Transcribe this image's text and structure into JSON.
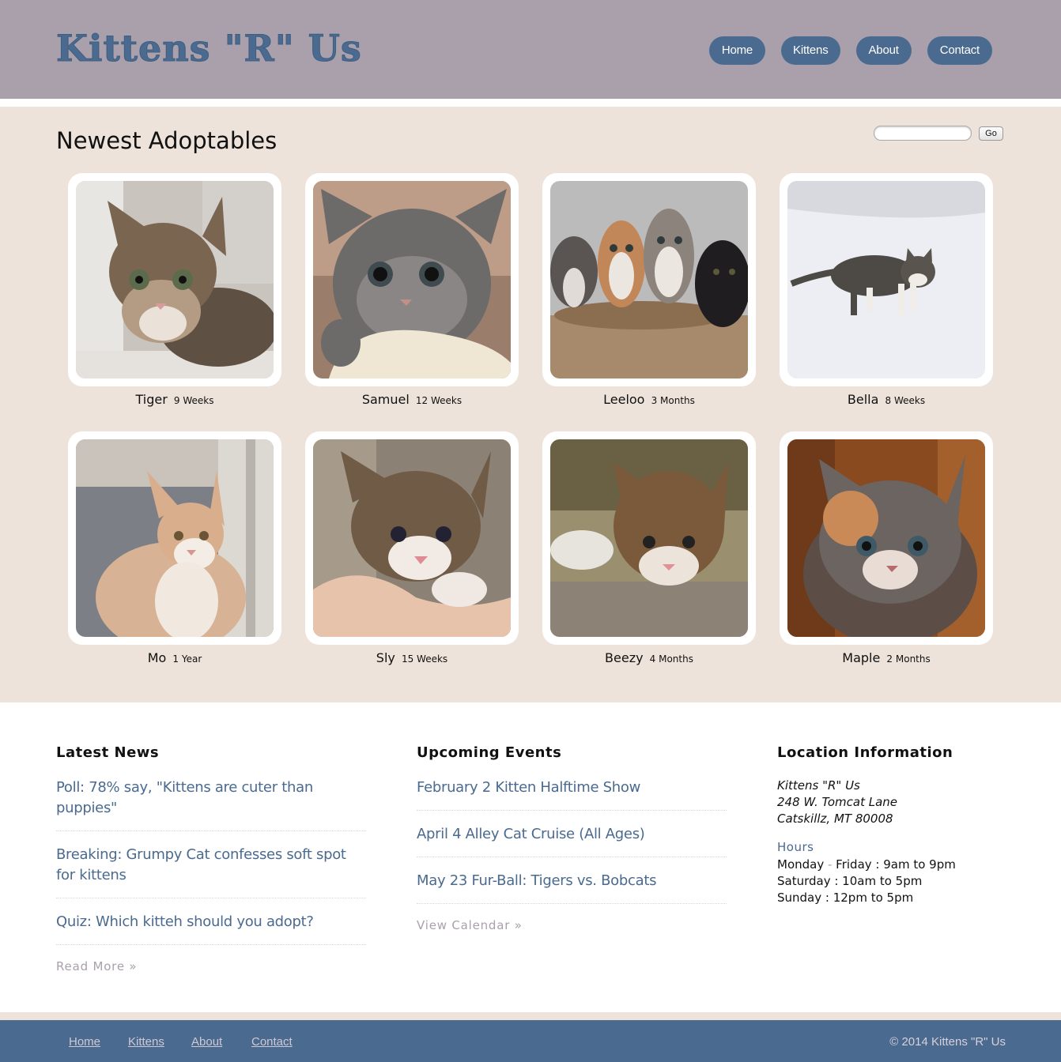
{
  "header": {
    "logo": "Kittens \"R\" Us",
    "nav": [
      "Home",
      "Kittens",
      "About",
      "Contact"
    ]
  },
  "adoptables": {
    "title": "Newest Adoptables",
    "search_placeholder": "",
    "go_label": "Go",
    "kittens": [
      {
        "name": "Tiger",
        "age": "9 Weeks"
      },
      {
        "name": "Samuel",
        "age": "12 Weeks"
      },
      {
        "name": "Leeloo",
        "age": "3 Months"
      },
      {
        "name": "Bella",
        "age": "8 Weeks"
      },
      {
        "name": "Mo",
        "age": "1 Year"
      },
      {
        "name": "Sly",
        "age": "15 Weeks"
      },
      {
        "name": "Beezy",
        "age": "4 Months"
      },
      {
        "name": "Maple",
        "age": "2 Months"
      }
    ]
  },
  "news": {
    "title": "Latest News",
    "items": [
      {
        "line1": "Poll: 78% say, \"Kittens are cuter than",
        "line2": "puppies\""
      },
      {
        "line1": "Breaking: Grumpy Cat confesses soft spot",
        "line2": "for kittens"
      },
      {
        "line1": "Quiz: Which kitteh should you adopt?",
        "line2": ""
      }
    ],
    "more": "Read More »"
  },
  "events": {
    "title": "Upcoming Events",
    "items": [
      "February 2 Kitten Halftime Show",
      "April 4 Alley Cat Cruise (All Ages)",
      "May 23 Fur-Ball: Tigers vs. Bobcats"
    ],
    "more": "View Calendar »"
  },
  "location": {
    "title": "Location Information",
    "address": [
      "Kittens \"R\" Us",
      "248 W. Tomcat Lane",
      "Catskillz, MT 80008"
    ],
    "hours_title": "Hours",
    "hours": [
      {
        "a": "Monday",
        "dash": " - ",
        "b": "Friday : 9am to 9pm"
      },
      {
        "a": "Saturday : 10am to 5pm",
        "dash": "",
        "b": ""
      },
      {
        "a": "Sunday : 12pm to 5pm",
        "dash": "",
        "b": ""
      }
    ]
  },
  "footer": {
    "links": [
      "Home",
      "Kittens",
      "About",
      "Contact"
    ],
    "copyright": "© 2014 Kittens \"R\" Us"
  },
  "colors": {
    "header_bg": "#a9a0ab",
    "accent": "#4a6a8f",
    "beige": "#ede3da"
  }
}
